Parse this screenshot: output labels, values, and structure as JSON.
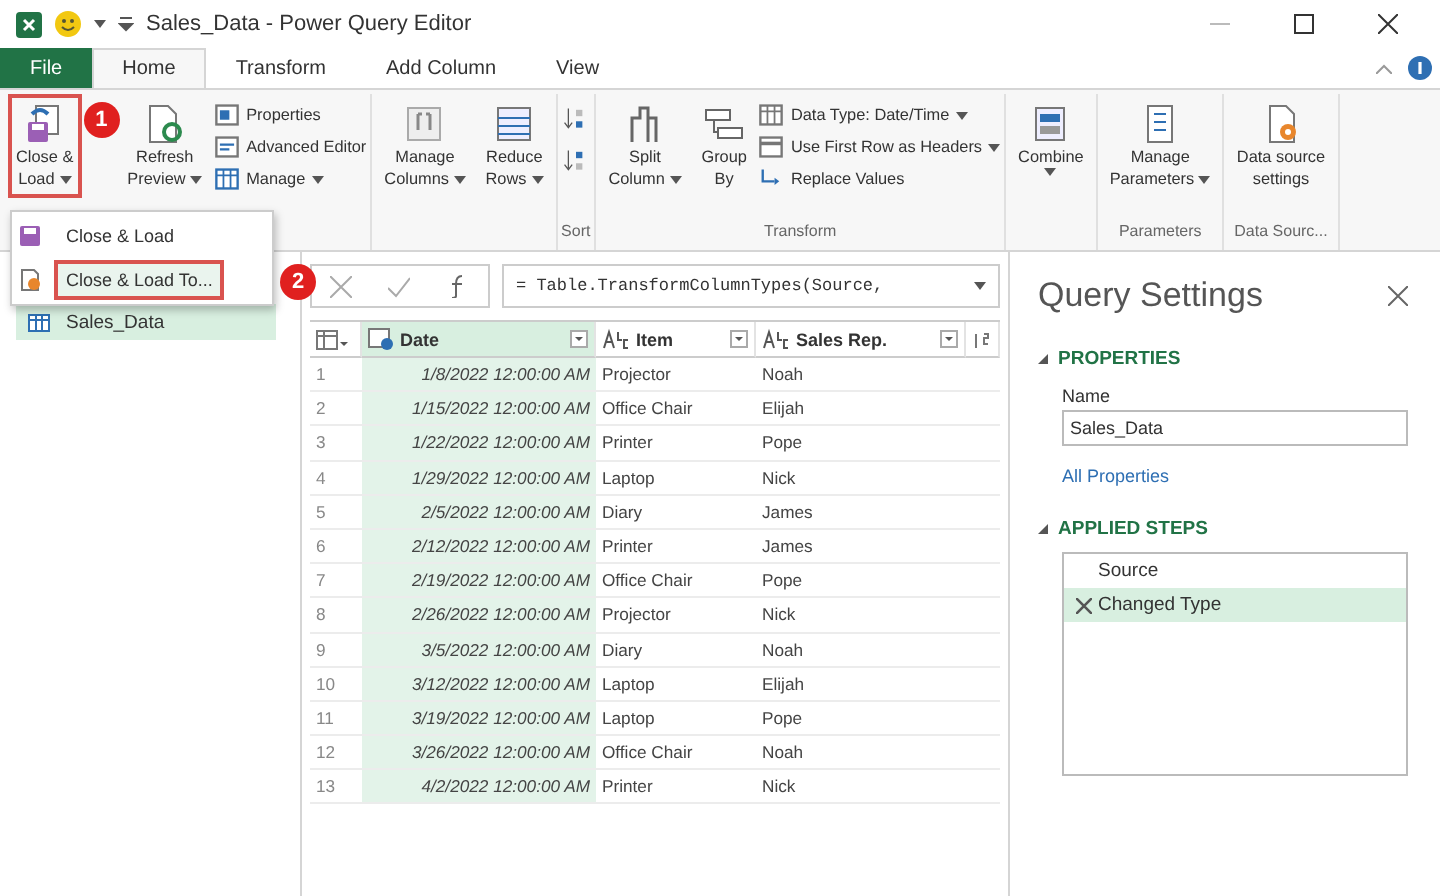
{
  "window": {
    "title": "Sales_Data - Power Query Editor"
  },
  "ribbon_tabs": [
    {
      "label": "File",
      "kind": "file",
      "selected": false
    },
    {
      "label": "Home",
      "kind": "tab",
      "selected": true
    },
    {
      "label": "Transform",
      "kind": "tab",
      "selected": false
    },
    {
      "label": "Add Column",
      "kind": "tab",
      "selected": false
    },
    {
      "label": "View",
      "kind": "tab",
      "selected": false
    }
  ],
  "ribbon_groups": [
    {
      "items": [
        {
          "kind": "large",
          "lines": [
            "Close &",
            "Load"
          ],
          "dropdown": true,
          "outlined": true,
          "badge": "1"
        },
        {
          "kind": "large",
          "lines": [
            "Refresh",
            "Preview"
          ],
          "dropdown": true,
          "outlined": false
        },
        {
          "kind": "stack",
          "entries": [
            {
              "label": "Properties",
              "dropdown": false
            },
            {
              "label": "Advanced Editor",
              "dropdown": false
            },
            {
              "label": "Manage",
              "dropdown": true
            }
          ]
        }
      ]
    },
    {
      "items": [
        {
          "kind": "large",
          "lines": [
            "Manage",
            "Columns"
          ],
          "dropdown": true,
          "outlined": false
        },
        {
          "kind": "large",
          "lines": [
            "Reduce",
            "Rows"
          ],
          "dropdown": true,
          "outlined": false
        }
      ]
    },
    {
      "label": "Sort",
      "items": [
        {
          "kind": "sort"
        }
      ]
    },
    {
      "label": "Transform",
      "items": [
        {
          "kind": "large",
          "lines": [
            "Split",
            "Column"
          ],
          "dropdown": true,
          "outlined": false
        },
        {
          "kind": "large",
          "lines": [
            "Group",
            "By"
          ],
          "dropdown": false,
          "outlined": false
        },
        {
          "kind": "stack",
          "entries": [
            {
              "label": "Data Type: Date/Time",
              "dropdown": true
            },
            {
              "label": "Use First Row as Headers",
              "dropdown": true
            },
            {
              "label": "Replace Values",
              "dropdown": false
            }
          ]
        }
      ]
    },
    {
      "items": [
        {
          "kind": "large",
          "lines": [
            "Combine"
          ],
          "dropdown": true,
          "outlined": false
        }
      ]
    },
    {
      "label": "Parameters",
      "items": [
        {
          "kind": "large",
          "lines": [
            "Manage",
            "Parameters"
          ],
          "dropdown": true,
          "outlined": false
        }
      ]
    },
    {
      "label": "Data Sourc...",
      "items": [
        {
          "kind": "large",
          "lines": [
            "Data source",
            "settings"
          ],
          "dropdown": false,
          "outlined": false
        }
      ]
    }
  ],
  "menu": {
    "items": [
      {
        "label": "Close & Load",
        "selected": false,
        "outlined": false
      },
      {
        "label": "Close & Load To...",
        "selected": true,
        "outlined": true,
        "badge": "2"
      }
    ]
  },
  "queries": {
    "items": [
      {
        "label": "Sales_Data",
        "selected": true
      }
    ]
  },
  "formula_bar": {
    "formula": "= Table.TransformColumnTypes(Source,"
  },
  "table": {
    "columns": [
      {
        "label": "Date",
        "kind": "date",
        "selected": true
      },
      {
        "label": "Item",
        "kind": "text",
        "selected": false
      },
      {
        "label": "Sales Rep.",
        "kind": "text",
        "selected": false
      }
    ],
    "rows": [
      {
        "index": "1",
        "cells": [
          "1/8/2022 12:00:00 AM",
          "Projector",
          "Noah"
        ]
      },
      {
        "index": "2",
        "cells": [
          "1/15/2022 12:00:00 AM",
          "Office Chair",
          "Elijah"
        ]
      },
      {
        "index": "3",
        "cells": [
          "1/22/2022 12:00:00 AM",
          "Printer",
          "Pope"
        ]
      },
      {
        "index": "4",
        "cells": [
          "1/29/2022 12:00:00 AM",
          "Laptop",
          "Nick"
        ]
      },
      {
        "index": "5",
        "cells": [
          "2/5/2022 12:00:00 AM",
          "Diary",
          "James"
        ]
      },
      {
        "index": "6",
        "cells": [
          "2/12/2022 12:00:00 AM",
          "Printer",
          "James"
        ]
      },
      {
        "index": "7",
        "cells": [
          "2/19/2022 12:00:00 AM",
          "Office Chair",
          "Pope"
        ]
      },
      {
        "index": "8",
        "cells": [
          "2/26/2022 12:00:00 AM",
          "Projector",
          "Nick"
        ]
      },
      {
        "index": "9",
        "cells": [
          "3/5/2022 12:00:00 AM",
          "Diary",
          "Noah"
        ]
      },
      {
        "index": "10",
        "cells": [
          "3/12/2022 12:00:00 AM",
          "Laptop",
          "Elijah"
        ]
      },
      {
        "index": "11",
        "cells": [
          "3/19/2022 12:00:00 AM",
          "Laptop",
          "Pope"
        ]
      },
      {
        "index": "12",
        "cells": [
          "3/26/2022 12:00:00 AM",
          "Office Chair",
          "Noah"
        ]
      },
      {
        "index": "13",
        "cells": [
          "4/2/2022 12:00:00 AM",
          "Printer",
          "Nick"
        ]
      }
    ]
  },
  "query_settings": {
    "title": "Query Settings",
    "properties_heading": "PROPERTIES",
    "name_label": "Name",
    "name_value": "Sales_Data",
    "all_properties": "All Properties",
    "steps_heading": "APPLIED STEPS",
    "steps": [
      {
        "label": "Source",
        "selected": false,
        "deletable": false
      },
      {
        "label": "Changed Type",
        "selected": true,
        "deletable": true
      }
    ]
  }
}
